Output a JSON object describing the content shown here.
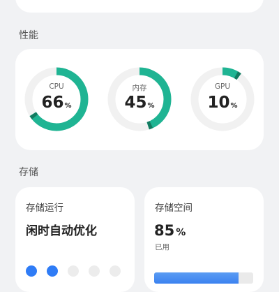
{
  "performance": {
    "title": "性能",
    "gauges": [
      {
        "label": "CPU",
        "value": "66",
        "unit": "%",
        "fraction": 0.66
      },
      {
        "label": "内存",
        "value": "45",
        "unit": "%",
        "fraction": 0.45
      },
      {
        "label": "GPU",
        "value": "10",
        "unit": "%",
        "fraction": 0.1
      }
    ],
    "colors": {
      "arc": "#1fb493",
      "arc_end": "#137a60",
      "track": "#f1f1f1"
    }
  },
  "storage": {
    "title": "存储",
    "run_card": {
      "title": "存储运行",
      "status": "闲时自动优化",
      "active_dots": 2,
      "total_dots": 5
    },
    "space_card": {
      "title": "存储空间",
      "value": "85",
      "unit": "%",
      "sub_label": "已用",
      "fraction": 0.85
    },
    "colors": {
      "accent": "#2f7cf6"
    }
  }
}
